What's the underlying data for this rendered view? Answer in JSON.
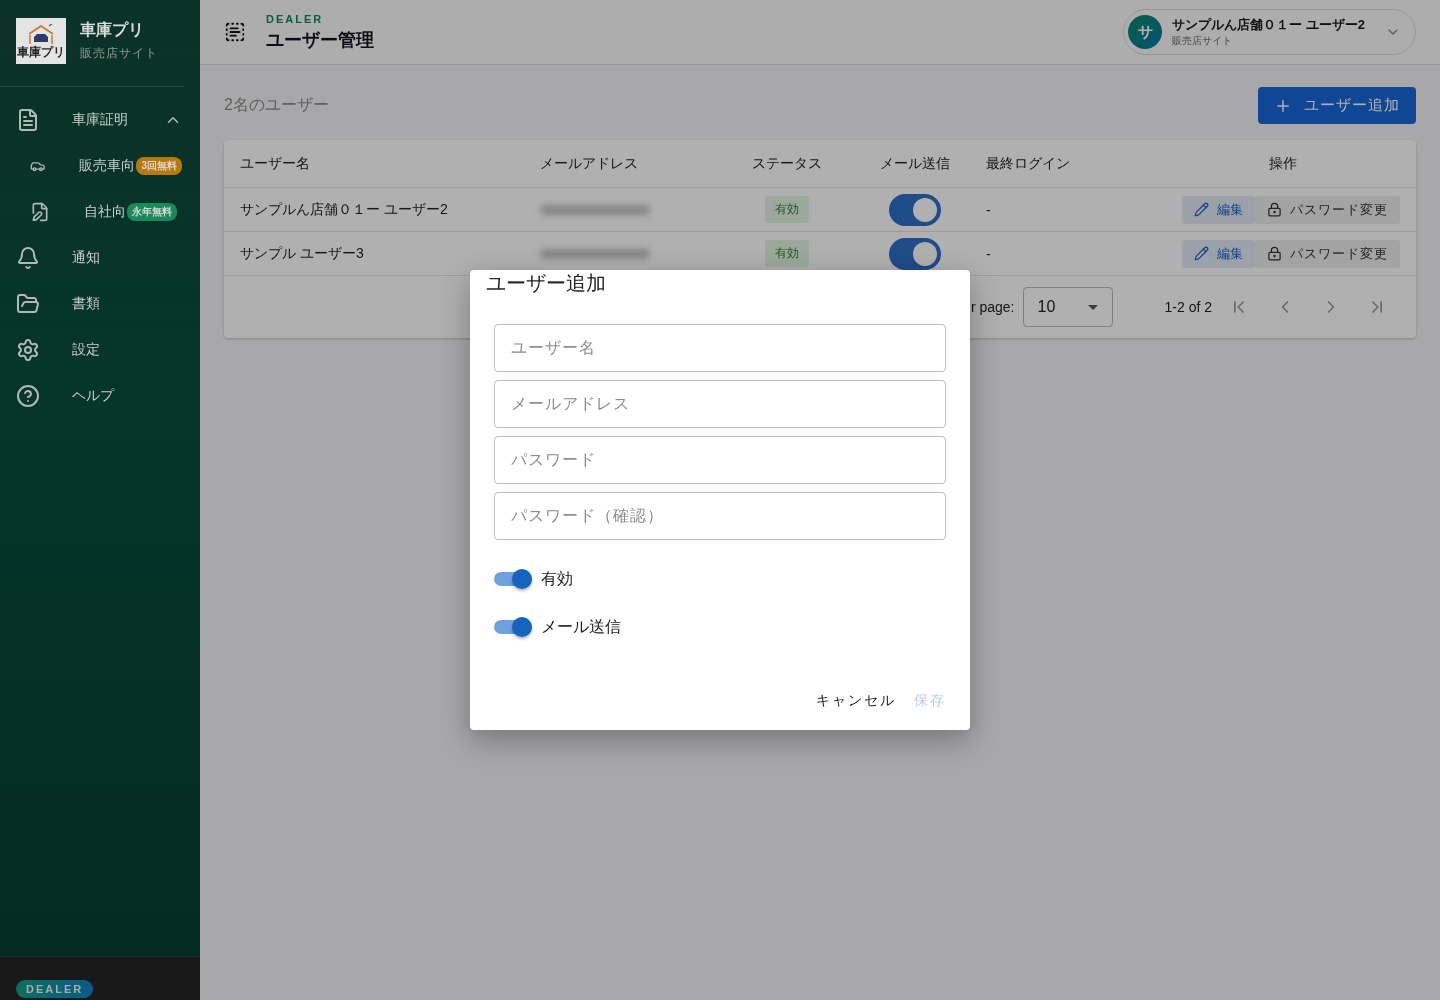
{
  "sidebar": {
    "logo_caption": "車庫プリ",
    "app_name": "車庫プリ",
    "subtitle": "販売店サイト",
    "items": [
      {
        "label": "車庫証明",
        "expanded": true,
        "children": [
          {
            "label": "販売車向",
            "badge": {
              "text": "3回無料",
              "color": "#b8780a"
            }
          },
          {
            "label": "自社向",
            "badge": {
              "text": "永年無料",
              "color": "#1a8a5a"
            }
          }
        ]
      },
      {
        "label": "通知"
      },
      {
        "label": "書類"
      },
      {
        "label": "設定"
      },
      {
        "label": "ヘルプ"
      }
    ],
    "footer_badge": "DEALER"
  },
  "header": {
    "eyebrow": "DEALER",
    "title": "ユーザー管理",
    "user": {
      "avatar": "サ",
      "name": "サンプルん店舗０１ー ユーザー2",
      "subtitle": "販売店サイト"
    }
  },
  "content": {
    "count_label": "2名のユーザー",
    "add_button": "ユーザー追加",
    "table": {
      "columns": [
        "ユーザー名",
        "メールアドレス",
        "ステータス",
        "メール送信",
        "最終ログイン",
        "操作"
      ],
      "rows": [
        {
          "name": "サンプルん店舗０１ー ユーザー2",
          "email_redacted": true,
          "status": "有効",
          "mail": true,
          "last_login": "-",
          "edit": "編集",
          "password": "パスワード変更"
        },
        {
          "name": "サンプル ユーザー3",
          "email_redacted": true,
          "status": "有効",
          "mail": true,
          "last_login": "-",
          "edit": "編集",
          "password": "パスワード変更"
        }
      ],
      "pagination": {
        "rows_label": "r page:",
        "rows_value": "10",
        "range": "1-2 of 2"
      }
    }
  },
  "dialog": {
    "title": "ユーザー追加",
    "fields": [
      {
        "placeholder": "ユーザー名"
      },
      {
        "placeholder": "メールアドレス"
      },
      {
        "placeholder": "パスワード"
      },
      {
        "placeholder": "パスワード（確認）"
      }
    ],
    "toggles": [
      {
        "label": "有効",
        "on": true
      },
      {
        "label": "メール送信",
        "on": true
      }
    ],
    "cancel": "キャンセル",
    "save": {
      "label": "保存",
      "disabled": true
    }
  }
}
